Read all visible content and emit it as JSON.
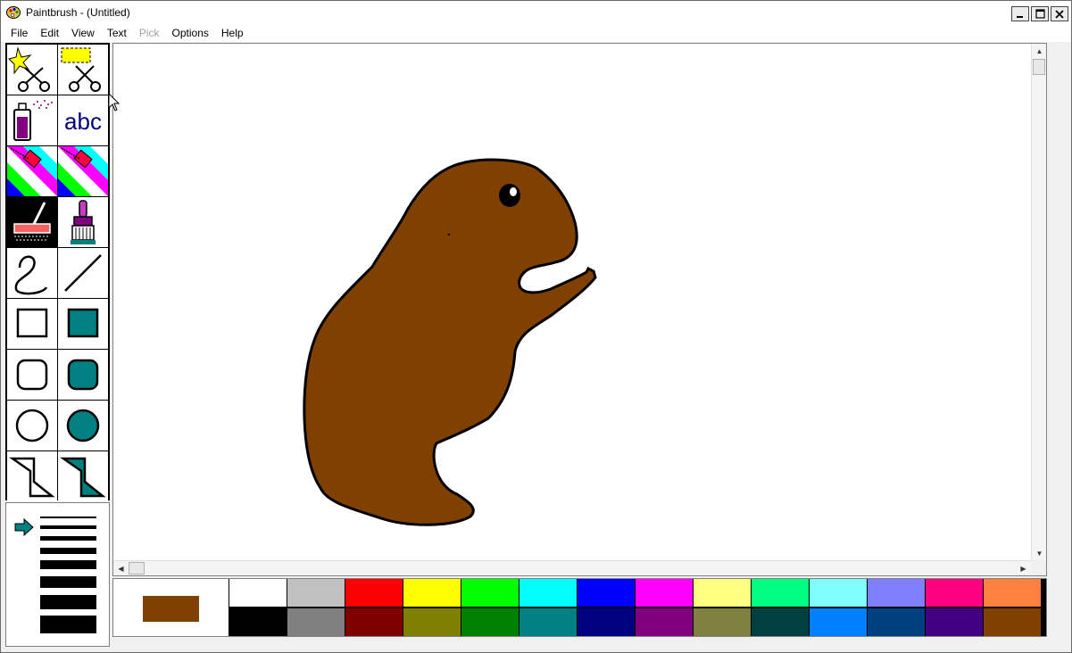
{
  "window": {
    "title": "Paintbrush - (Untitled)"
  },
  "icons": {
    "app": "palette-icon",
    "minimize": "minimize-icon",
    "maximize": "maximize-icon",
    "close": "close-icon"
  },
  "menu": [
    {
      "label": "File",
      "enabled": true
    },
    {
      "label": "Edit",
      "enabled": true
    },
    {
      "label": "View",
      "enabled": true
    },
    {
      "label": "Text",
      "enabled": true
    },
    {
      "label": "Pick",
      "enabled": false
    },
    {
      "label": "Options",
      "enabled": true
    },
    {
      "label": "Help",
      "enabled": true
    }
  ],
  "toolbox": {
    "text_tool_label": "abc",
    "tools": [
      "scissors-star",
      "scissors-rect",
      "airbrush",
      "text",
      "color-eraser",
      "eraser",
      "paint-roller",
      "brush",
      "curve",
      "line",
      "box",
      "filled-box",
      "rounded-box",
      "filled-rounded-box",
      "circle",
      "filled-circle",
      "polygon",
      "filled-polygon"
    ],
    "selected_tool": "paint-roller"
  },
  "colors": {
    "tool_accent": "#008080",
    "foreground": "#804000",
    "animal": "#804000"
  },
  "palette": {
    "top": [
      "#ffffff",
      "#c0c0c0",
      "#ff0000",
      "#ffff00",
      "#00ff00",
      "#00ffff",
      "#0000ff",
      "#ff00ff",
      "#ffff80",
      "#00ff80",
      "#80ffff",
      "#8080ff",
      "#ff0080",
      "#ff8040"
    ],
    "bottom": [
      "#000000",
      "#808080",
      "#800000",
      "#808000",
      "#008000",
      "#008080",
      "#000080",
      "#800080",
      "#808040",
      "#004040",
      "#0080ff",
      "#004080",
      "#400080",
      "#804000"
    ]
  }
}
